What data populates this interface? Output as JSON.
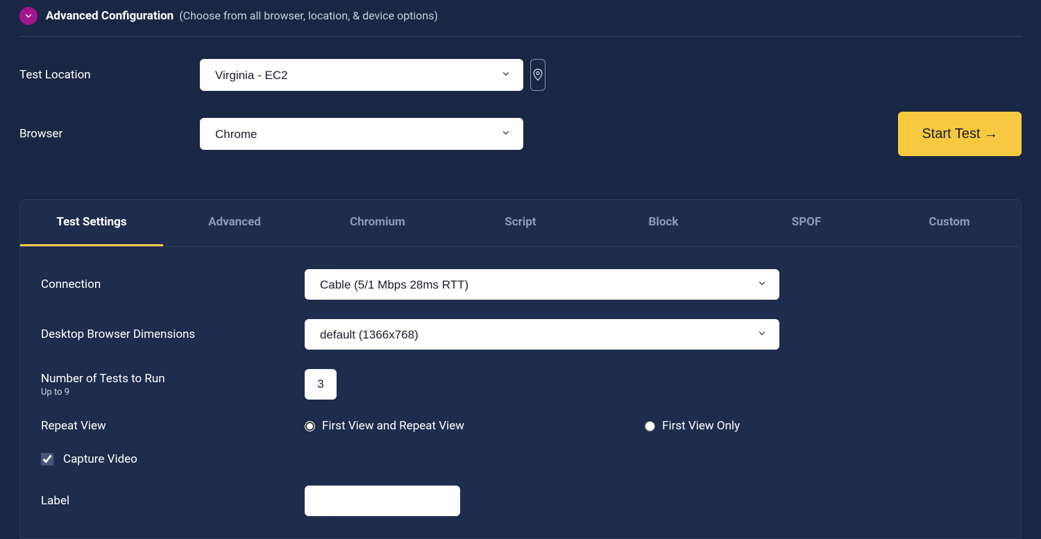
{
  "header": {
    "title": "Advanced Configuration",
    "subtitle": "(Choose from all browser, location, & device options)"
  },
  "topForm": {
    "locationLabel": "Test Location",
    "locationValue": "Virginia - EC2",
    "browserLabel": "Browser",
    "browserValue": "Chrome",
    "startButton": "Start Test →"
  },
  "tabs": [
    "Test Settings",
    "Advanced",
    "Chromium",
    "Script",
    "Block",
    "SPOF",
    "Custom"
  ],
  "activeTab": 0,
  "settings": {
    "connectionLabel": "Connection",
    "connectionValue": "Cable (5/1 Mbps 28ms RTT)",
    "dimensionsLabel": "Desktop Browser Dimensions",
    "dimensionsValue": "default (1366x768)",
    "numTestsLabel": "Number of Tests to Run",
    "numTestsHint": "Up to 9",
    "numTestsValue": "3",
    "repeatViewLabel": "Repeat View",
    "repeatOpt1": "First View and Repeat View",
    "repeatOpt2": "First View Only",
    "repeatSelected": "first_and_repeat",
    "captureVideoLabel": "Capture Video",
    "captureVideoChecked": true,
    "labelLabel": "Label",
    "labelValue": ""
  }
}
